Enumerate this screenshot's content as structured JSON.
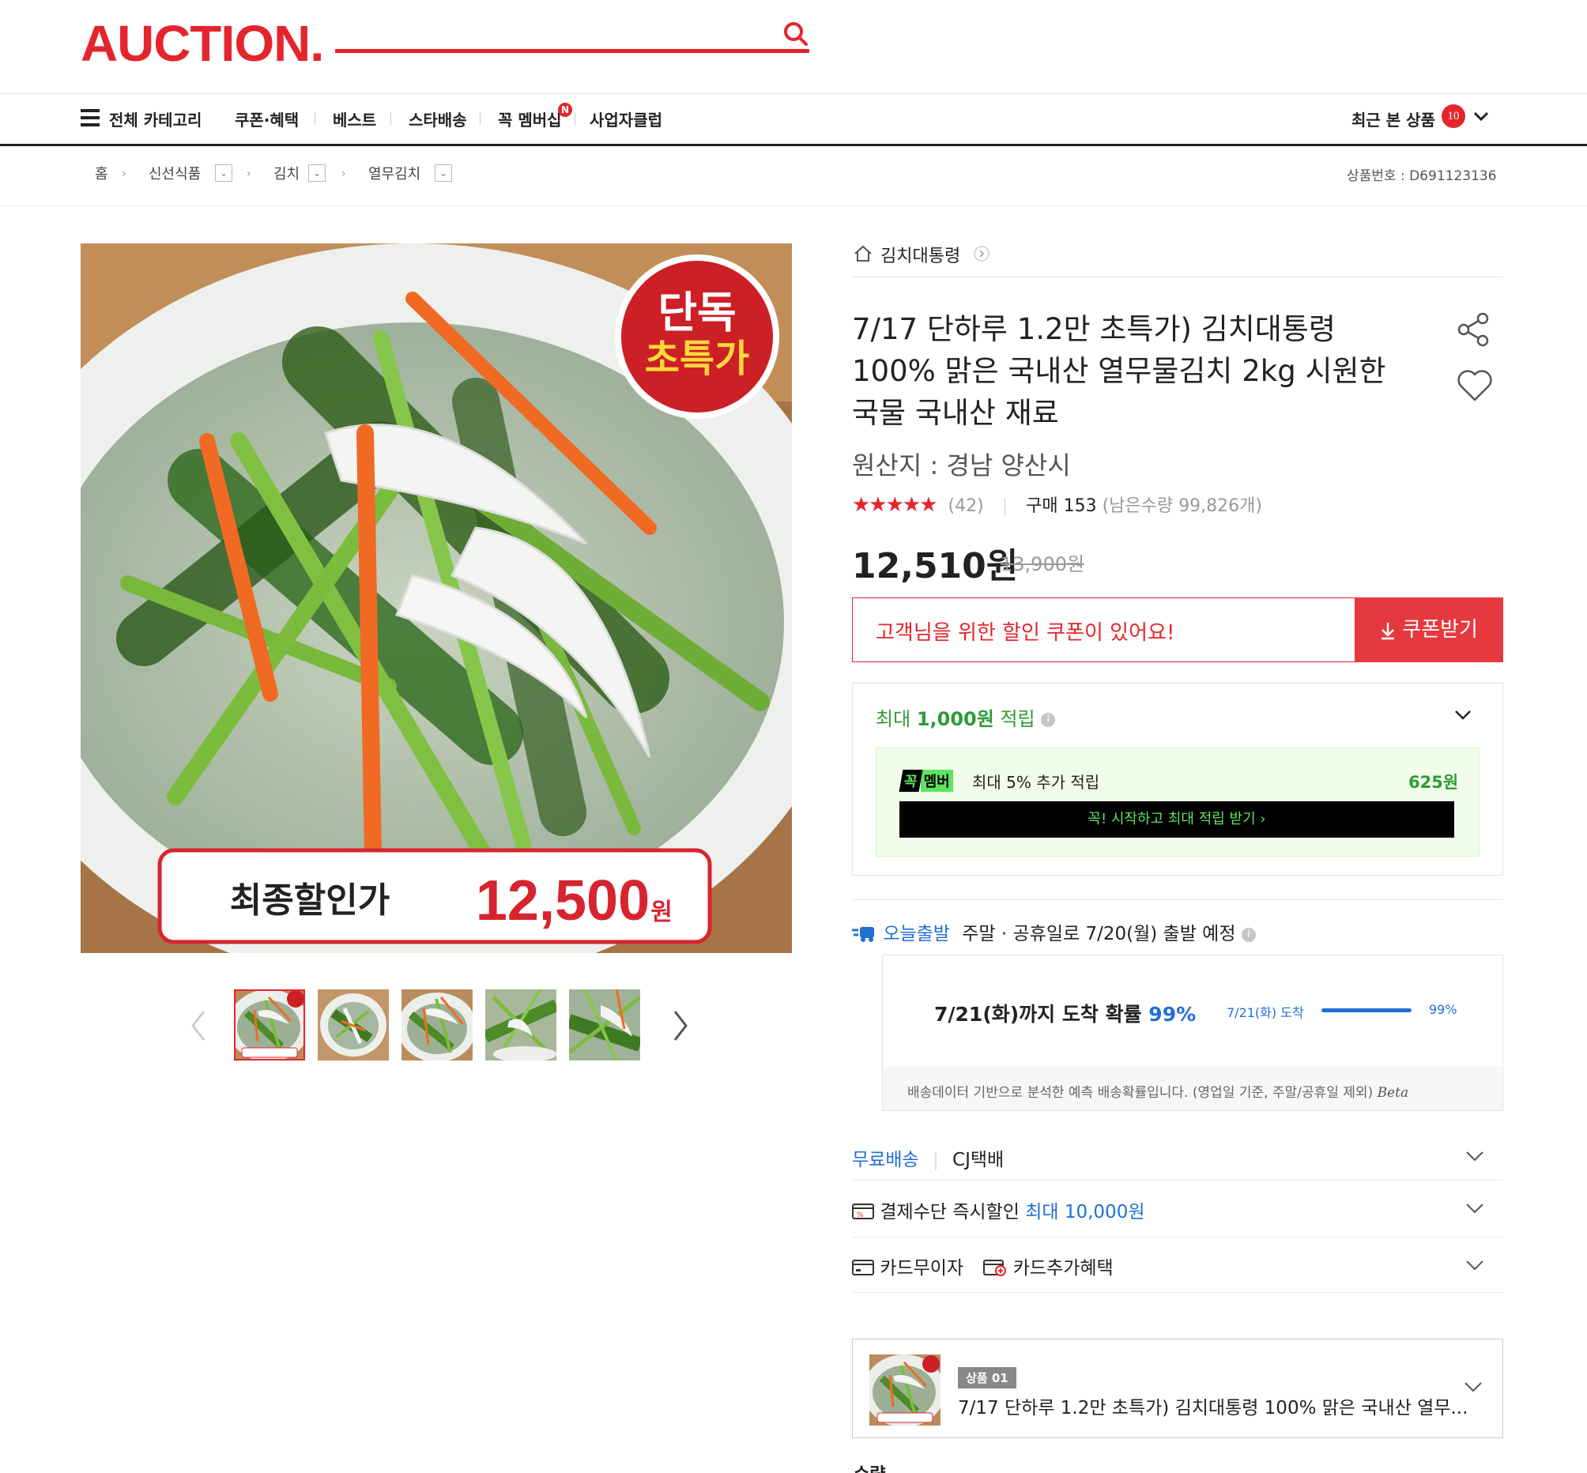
{
  "header": {
    "logo": "AUCTION.",
    "search_placeholder": ""
  },
  "nav": {
    "all_categories": "전체 카테고리",
    "items": [
      "쿠폰·혜택",
      "베스트",
      "스타배송",
      "꼭 멤버십",
      "사업자클럽"
    ],
    "membership_badge": "N",
    "recent_label": "최근 본 상품",
    "recent_count": "10"
  },
  "breadcrumb": {
    "home": "홈",
    "levels": [
      "신선식품",
      "김치",
      "열무김치"
    ],
    "product_no": "상품번호 : D691123136"
  },
  "image": {
    "badge_line1": "단독",
    "badge_line2": "초특가",
    "final_label": "최종할인가",
    "final_price": "12,500",
    "final_unit": "원"
  },
  "product": {
    "store": "김치대통령",
    "title": "7/17 단하루 1.2만 초특가) 김치대통령 100% 맑은 국내산 열무물김치 2kg 시원한 국물 국내산 재료",
    "origin": "원산지 : 경남 양산시",
    "stars": "★★★★★",
    "review_count": "(42)",
    "purchase": "구매 153",
    "stock": "(남은수량 99,826개)",
    "price": "12,510원",
    "old_price": "13,900원",
    "rating": 5
  },
  "coupon": {
    "text": "고객님을 위한 할인 쿠폰이 있어요!",
    "button": "쿠폰받기"
  },
  "points": {
    "prefix": "최대",
    "amount": "1,000원",
    "suffix": "적립",
    "member_logo_a": "꼭",
    "member_logo_b": "멤버",
    "member_text": "최대 5% 추가 적립",
    "member_amount": "625원",
    "member_button": "꼭! 시작하고 최대 적립 받기 ›"
  },
  "shipping": {
    "today_label": "오늘출발",
    "today_text": "주말 · 공휴일로 7/20(월) 출발 예정",
    "arrival_text": "7/21(화)까지 도착 확률",
    "arrival_pct": "99%",
    "arrival_small": "7/21(화) 도착",
    "arrival_small_pct": "99%",
    "arrival_probability": 0.99,
    "note": "배송데이터 기반으로 분석한 예측 배송확률입니다. (영업일 기준, 주말/공휴일 제외)",
    "note_beta": "Beta"
  },
  "rows": {
    "free_ship": "무료배송",
    "courier": "CJ택배",
    "pay_discount": "결제수단 즉시할인",
    "pay_max": "최대 10,000원",
    "card_interest": "카드무이자",
    "card_benefit": "카드추가혜택"
  },
  "option": {
    "badge": "상품 01",
    "title": "7/17 단하루 1.2만 초특가) 김치대통령 100% 맑은 국내산 열무..."
  },
  "quantity_label": "수량",
  "colors": {
    "brand": "#e5252d",
    "link": "#1f6fd6",
    "green": "#2f9b3a"
  }
}
